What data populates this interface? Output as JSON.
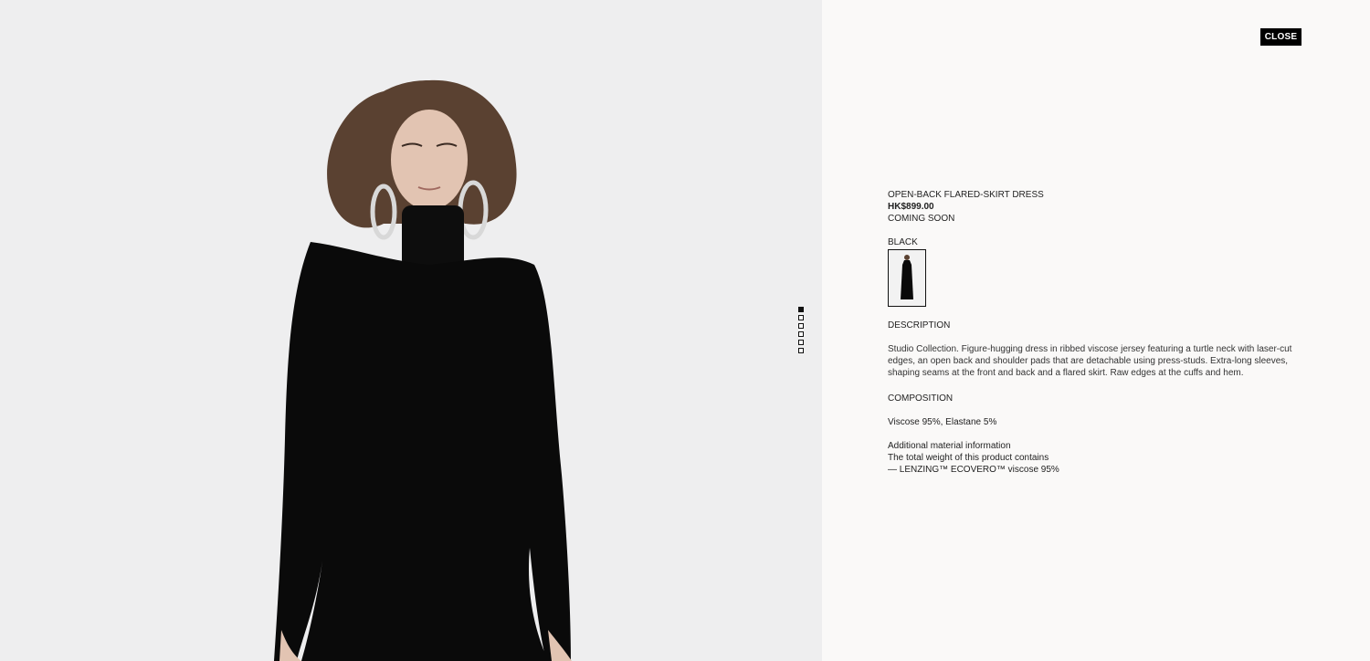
{
  "gallery": {
    "image_alt": "Model wearing open-back flared-skirt dress",
    "pager_count": 6,
    "pager_active": 0
  },
  "close_label": "CLOSE",
  "product": {
    "name": "OPEN-BACK FLARED-SKIRT DRESS",
    "price": "HK$899.00",
    "availability": "COMING SOON",
    "color_label": "BLACK",
    "description_heading": "DESCRIPTION",
    "description": "Studio Collection. Figure-hugging dress in ribbed viscose jersey featuring a turtle neck with laser-cut edges, an open back and shoulder pads that are detachable using press-studs. Extra-long sleeves, shaping seams at the front and back and a flared skirt. Raw edges at the cuffs and hem.",
    "composition_heading": "COMPOSITION",
    "composition": "Viscose 95%, Elastane 5%",
    "material_title": "Additional material information",
    "material_line1": "The total weight of this product contains",
    "material_line2": "— LENZING™ ECOVERO™ viscose 95%"
  },
  "colors": {
    "accent": "#000000",
    "background": "#faf9f8",
    "image_bg": "#eeeeef"
  }
}
